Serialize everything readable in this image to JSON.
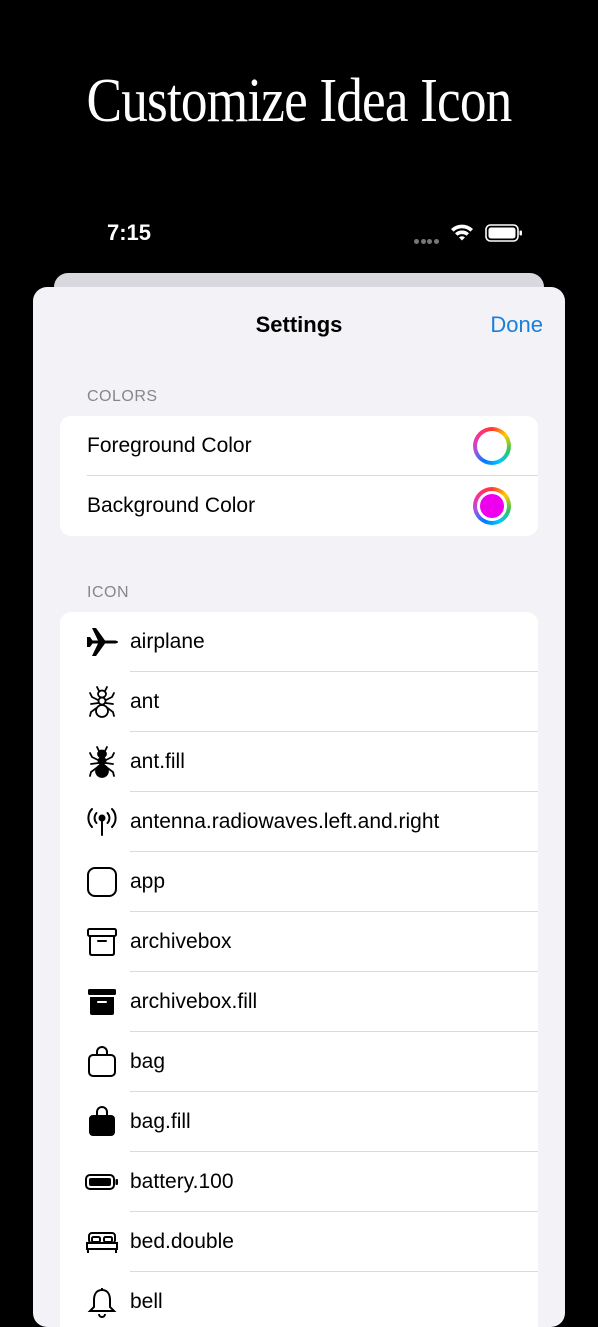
{
  "headline": "Customize Idea Icon",
  "status": {
    "time": "7:15"
  },
  "nav": {
    "title": "Settings",
    "done": "Done"
  },
  "colors_section": {
    "header": "COLORS",
    "rows": [
      {
        "label": "Foreground Color",
        "swatch": "#ffffff"
      },
      {
        "label": "Background Color",
        "swatch": "#ee00ee"
      }
    ]
  },
  "icon_section": {
    "header": "ICON",
    "items": [
      {
        "label": "airplane",
        "icon": "airplane-icon"
      },
      {
        "label": "ant",
        "icon": "ant-icon"
      },
      {
        "label": "ant.fill",
        "icon": "ant-fill-icon"
      },
      {
        "label": "antenna.radiowaves.left.and.right",
        "icon": "antenna-radiowaves-icon"
      },
      {
        "label": "app",
        "icon": "app-icon"
      },
      {
        "label": "archivebox",
        "icon": "archivebox-icon"
      },
      {
        "label": "archivebox.fill",
        "icon": "archivebox-fill-icon"
      },
      {
        "label": "bag",
        "icon": "bag-icon"
      },
      {
        "label": "bag.fill",
        "icon": "bag-fill-icon"
      },
      {
        "label": "battery.100",
        "icon": "battery-100-icon"
      },
      {
        "label": "bed.double",
        "icon": "bed-double-icon"
      },
      {
        "label": "bell",
        "icon": "bell-icon"
      }
    ]
  }
}
